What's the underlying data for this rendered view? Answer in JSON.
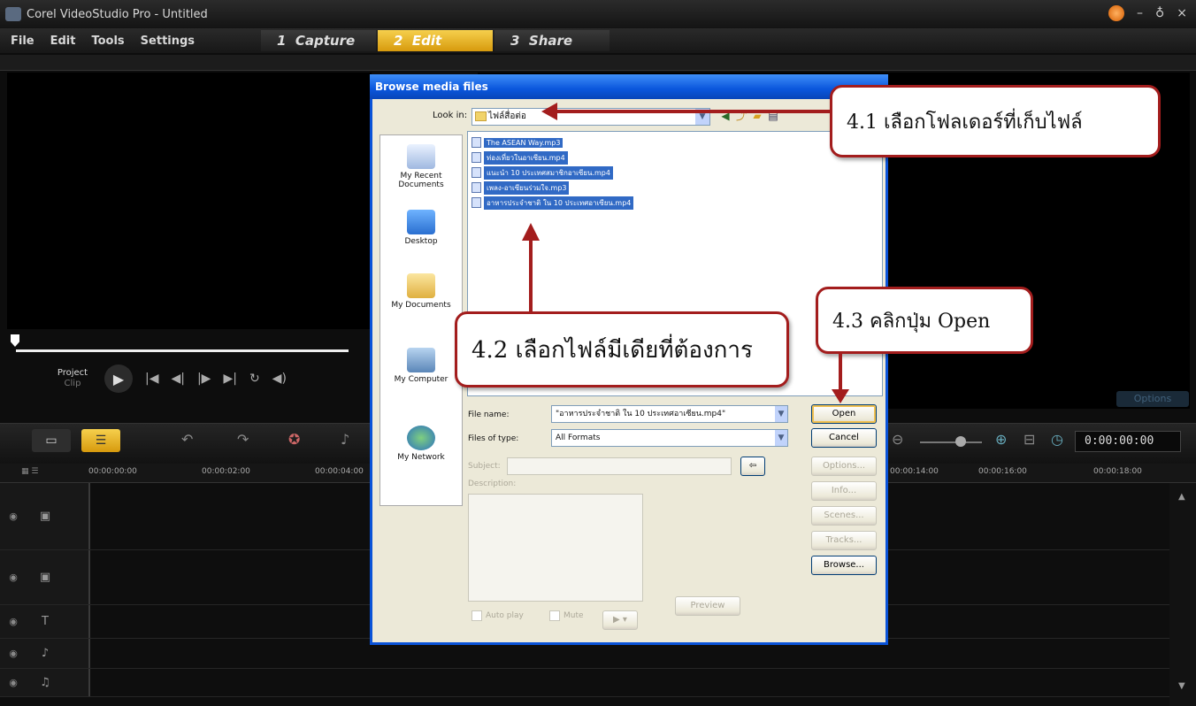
{
  "app": {
    "title": "Corel VideoStudio Pro - Untitled"
  },
  "window_controls": {
    "minimize": "–",
    "restore": "♁",
    "close": "×"
  },
  "menu": [
    "File",
    "Edit",
    "Tools",
    "Settings"
  ],
  "steps": [
    {
      "num": "1",
      "label": "Capture"
    },
    {
      "num": "2",
      "label": "Edit"
    },
    {
      "num": "3",
      "label": "Share"
    }
  ],
  "player": {
    "project_label": "Project",
    "clip_label": "Clip",
    "controls": [
      "|◀",
      "◀|",
      "|▶",
      "▶|",
      "↻",
      "◀)"
    ]
  },
  "options_tab": "Options",
  "timeline": {
    "timecode": "0:00:00:00",
    "ruler_ticks": [
      "00:00:00:00",
      "00:00:02:00",
      "00:00:04:00",
      "00:00:14:00",
      "00:00:16:00",
      "00:00:18:00"
    ]
  },
  "dialog": {
    "title": "Browse media files",
    "look_in_label": "Look in:",
    "look_in_value": "ไฟล์สื่อต่อ",
    "places": [
      "My Recent Documents",
      "Desktop",
      "My Documents",
      "My Computer",
      "My Network"
    ],
    "files": [
      "The ASEAN Way.mp3",
      "ท่องเที่ยวในอาเซียน.mp4",
      "แนะนำ 10 ประเทศสมาชิกอาเซียน.mp4",
      "เพลง-อาเซียนร่วมใจ.mp3",
      "อาหารประจำชาติ ใน 10 ประเทศอาเซียน.mp4"
    ],
    "file_name_label": "File name:",
    "file_name_value": "\"อาหารประจำชาติ ใน 10 ประเทศอาเซียน.mp4\"",
    "files_of_type_label": "Files of type:",
    "files_of_type_value": "All Formats",
    "subject_label": "Subject:",
    "description_label": "Description:",
    "autoplay_label": "Auto play",
    "mute_label": "Mute",
    "preview_button": "Preview",
    "play_button": "▶ ▾",
    "buttons": {
      "open": "Open",
      "cancel": "Cancel",
      "options": "Options...",
      "info": "Info...",
      "scenes": "Scenes...",
      "tracks": "Tracks...",
      "browse": "Browse..."
    }
  },
  "callouts": {
    "c41": "4.1 เลือกโฟลเดอร์ที่เก็บไฟล์",
    "c42": "4.2 เลือกไฟล์มีเดียที่ต้องการ",
    "c43": "4.3 คลิกปุ่ม  Open"
  },
  "colors": {
    "callout_border": "#a31d1d",
    "active_step": "#f6d04d",
    "dialog_title": "#0a56dc",
    "selection": "#316ac5"
  }
}
